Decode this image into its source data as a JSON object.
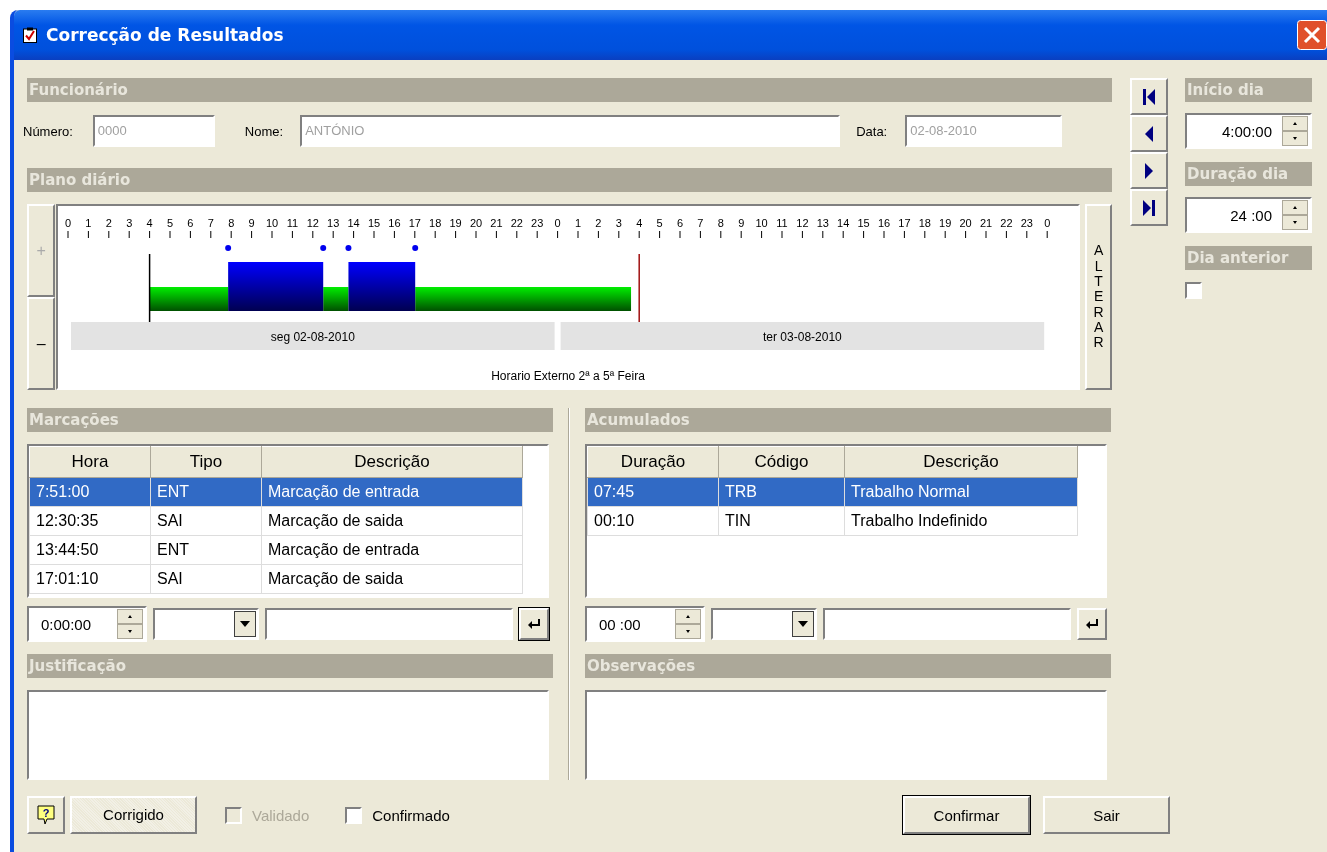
{
  "window": {
    "title": "Correcção de Resultados"
  },
  "funcionario": {
    "title": "Funcionário",
    "fields": [
      {
        "label": "Número:",
        "value": "0000",
        "disabled": true
      },
      {
        "label": "Nome:",
        "value": "ANTÓNIO",
        "disabled": true
      },
      {
        "label": "Data:",
        "value": "02-08-2010",
        "disabled": true
      }
    ]
  },
  "plano": {
    "title": "Plano diário",
    "zoom_in": "+",
    "zoom_out": "–",
    "hour_labels": [
      "0",
      "1",
      "2",
      "3",
      "4",
      "5",
      "6",
      "7",
      "8",
      "9",
      "10",
      "11",
      "12",
      "13",
      "14",
      "15",
      "16",
      "17",
      "18",
      "19",
      "20",
      "21",
      "22",
      "23",
      "0",
      "1",
      "2",
      "3",
      "4",
      "5",
      "6",
      "7",
      "8",
      "9",
      "10",
      "11",
      "12",
      "13",
      "14",
      "15",
      "16",
      "17",
      "18",
      "19",
      "20",
      "21",
      "22",
      "23",
      "0"
    ],
    "days": [
      "seg 02-08-2010",
      "ter 03-08-2010"
    ],
    "schedule": "Horario Externo 2ª a 5ª Feira",
    "change_button": "ALTERAR"
  },
  "side": {
    "inicio": {
      "title": "Início dia",
      "value": "4:00:00"
    },
    "duracao": {
      "title": "Duração dia",
      "value": "24 :00"
    },
    "dia_anterior": {
      "title": "Dia anterior",
      "checked": false
    }
  },
  "marcacoes": {
    "title": "Marcações",
    "columns": [
      "Hora",
      "Tipo",
      "Descrição"
    ],
    "rows": [
      {
        "cells": [
          "7:51:00",
          "ENT",
          "Marcação de entrada"
        ],
        "selected": true
      },
      {
        "cells": [
          "12:30:35",
          "SAI",
          "Marcação de saida"
        ],
        "selected": false
      },
      {
        "cells": [
          "13:44:50",
          "ENT",
          "Marcação de entrada"
        ],
        "selected": false
      },
      {
        "cells": [
          "17:01:10",
          "SAI",
          "Marcação de saida"
        ],
        "selected": false
      }
    ],
    "editor_time": "0:00:00"
  },
  "acumulados": {
    "title": "Acumulados",
    "columns": [
      "Duração",
      "Código",
      "Descrição"
    ],
    "rows": [
      {
        "cells": [
          "07:45",
          "TRB",
          "Trabalho Normal"
        ],
        "selected": true
      },
      {
        "cells": [
          "00:10",
          "TIN",
          "Trabalho Indefinido"
        ],
        "selected": false
      }
    ],
    "editor_time": "00 :00"
  },
  "justificacao": {
    "title": "Justificação"
  },
  "observacoes": {
    "title": "Observações"
  },
  "footer": {
    "help": "?",
    "status": "Corrigido",
    "checks": [
      {
        "label": "Validado",
        "checked": false,
        "disabled": true
      },
      {
        "label": "Confirmado",
        "checked": false,
        "disabled": false
      }
    ],
    "buttons": [
      "Confirmar",
      "Sair"
    ]
  }
}
